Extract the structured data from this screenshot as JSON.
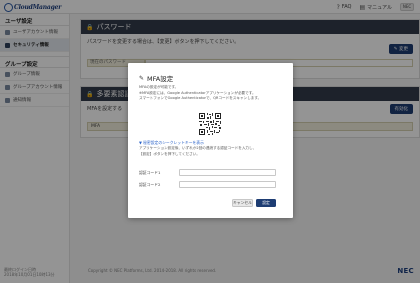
{
  "header": {
    "logo_text": "CloudManager",
    "faq_label": "FAQ",
    "manual_label": "マニュアル",
    "user_label": "NEC"
  },
  "sidebar": {
    "sections": [
      {
        "title": "ユーザ設定",
        "items": [
          {
            "label": "ユーザアカウント情報",
            "active": false
          },
          {
            "label": "セキュリティ情報",
            "active": true
          }
        ]
      },
      {
        "title": "グループ設定",
        "items": [
          {
            "label": "グループ情報",
            "active": false
          },
          {
            "label": "グループアカウント情報",
            "active": false
          },
          {
            "label": "通知情報",
            "active": false
          }
        ]
      }
    ],
    "footer_line1": "最終ログイン日時",
    "footer_line2": "2018年10月01日10時13分"
  },
  "main": {
    "password_card": {
      "title": "パスワード",
      "desc": "パスワードを変更する場合は、【変更】ボタンを押下してください。",
      "change_button": "変更",
      "field_label": "現在のパスワード"
    },
    "mfa_card": {
      "title": "多要素認証",
      "desc": "MFAを設定する",
      "enable_button": "有効化",
      "field_label": "MFA"
    },
    "copyright": "Copyright © NEC Platforms, Ltd. 2014-2018. All rights reserved.",
    "nec_logo": "NEC"
  },
  "modal": {
    "title": "MFA設定",
    "desc_line1": "MFAの設定が可能です。",
    "desc_line2": "※MFA設定には、Google Authenticatorアプリケーションが必要です。",
    "desc_line3": "スマートフォンでGoogle Authenticatorで、QRコードをスキャンします。",
    "secret_link": "▼ 秘密設定のシークレットキーを表示",
    "desc2_line1": "アプリケーション設定後、いずれか2回の連続する認証コードを入力し、",
    "desc2_line2": "【設定】ボタンを押下してください。",
    "code1_label": "認証コード1",
    "code2_label": "認証コード2",
    "cancel_button": "キャンセル",
    "ok_button": "設定"
  }
}
